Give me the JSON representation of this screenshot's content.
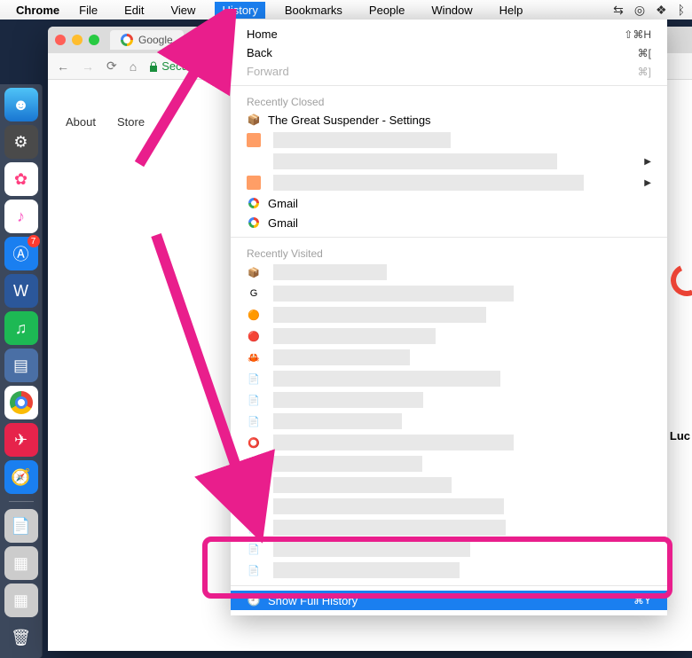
{
  "menubar": {
    "app": "Chrome",
    "items": [
      "File",
      "Edit",
      "View",
      "History",
      "Bookmarks",
      "People",
      "Window",
      "Help"
    ],
    "active_index": 3
  },
  "dock": {
    "appstore_badge": "7"
  },
  "browser": {
    "tab_title": "Google",
    "secure_label": "Secure",
    "page_links": [
      "About",
      "Store"
    ]
  },
  "dropdown": {
    "nav": [
      {
        "label": "Home",
        "shortcut": "⇧⌘H",
        "disabled": false
      },
      {
        "label": "Back",
        "shortcut": "⌘[",
        "disabled": false
      },
      {
        "label": "Forward",
        "shortcut": "⌘]",
        "disabled": true
      }
    ],
    "recently_closed_label": "Recently Closed",
    "recently_closed": [
      {
        "label": "The Great Suspender - Settings",
        "icon": "suspender"
      },
      {
        "label": "",
        "icon": "blur",
        "submenu": false
      },
      {
        "label": "",
        "icon": "blur",
        "submenu": true
      },
      {
        "label": "",
        "icon": "blur",
        "submenu": true
      },
      {
        "label": "Gmail",
        "icon": "google"
      },
      {
        "label": "Gmail",
        "icon": "google"
      }
    ],
    "recently_visited_label": "Recently Visited",
    "recently_visited_count": 15,
    "show_full": {
      "label": "Show Full History",
      "shortcut": "⌘Y"
    }
  },
  "partial": {
    "luc": "Luc"
  }
}
